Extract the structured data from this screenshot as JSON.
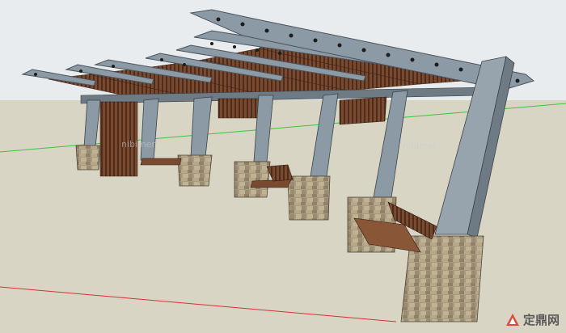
{
  "scene": {
    "subject": "pergola-with-benches-3d-model"
  },
  "watermark": {
    "text": "定鼎网"
  },
  "colors": {
    "sky": "#e8ecef",
    "ground": "#d8d5c5",
    "steel": "#8c9aa6",
    "steel_dark": "#5e6a74",
    "wood": "#6b3f2a",
    "stone": "#a89a80",
    "axis_green": "#3cc43c",
    "axis_red": "#d83030"
  }
}
